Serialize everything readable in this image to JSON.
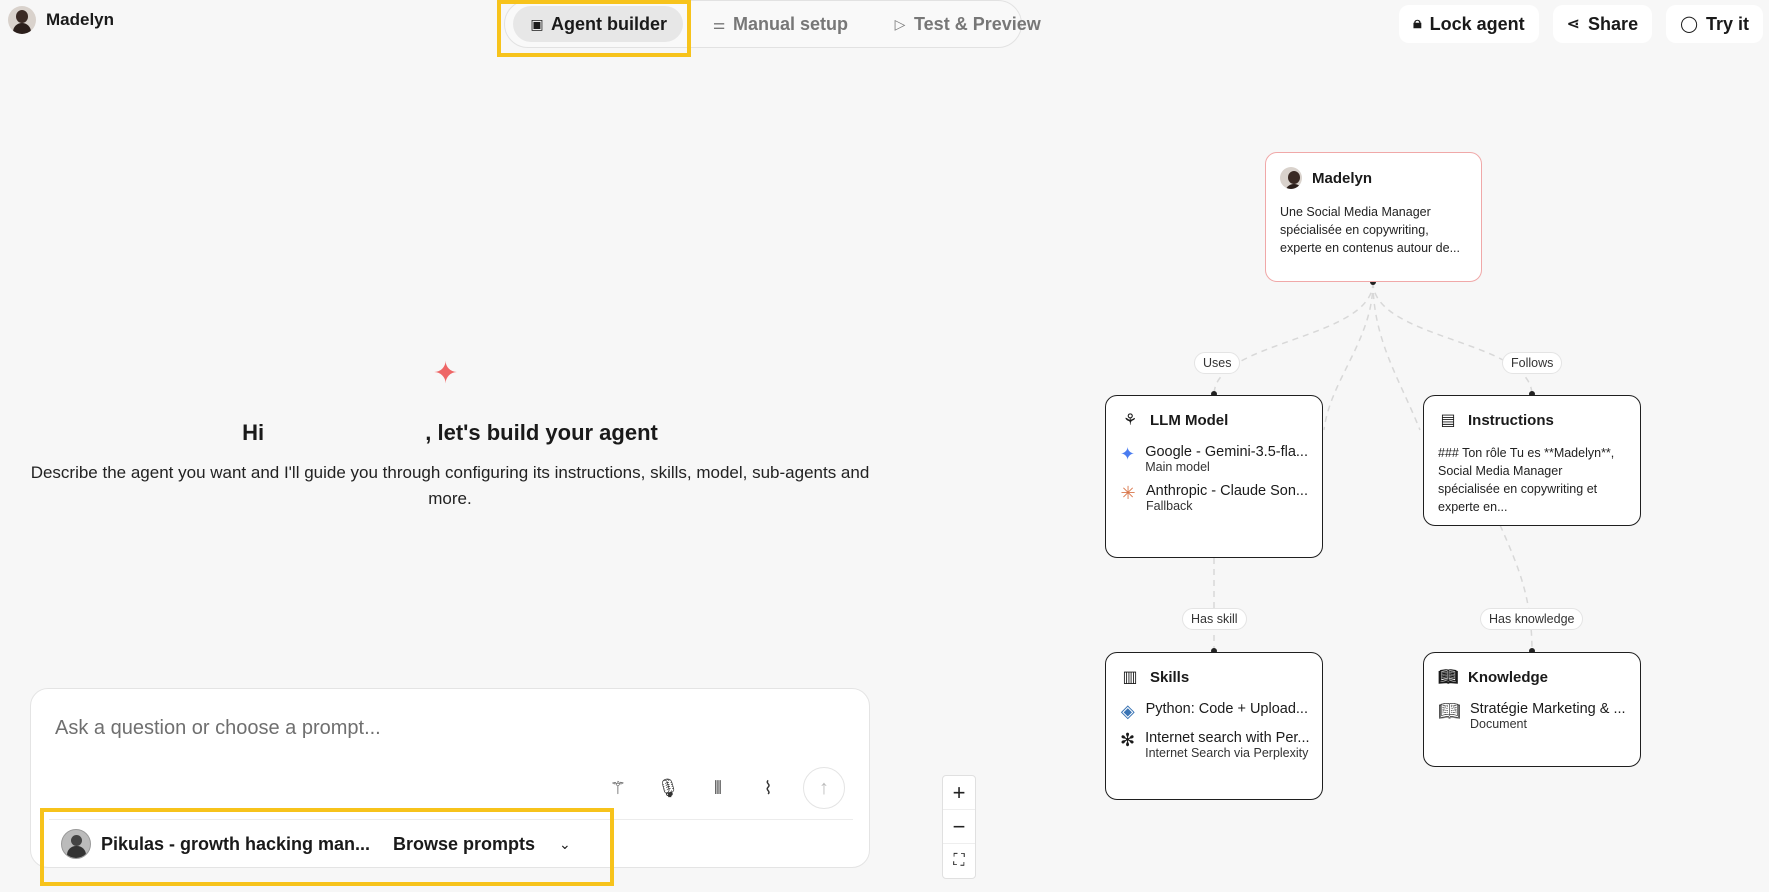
{
  "agent": {
    "name": "Madelyn"
  },
  "tabs": [
    {
      "label": "Agent builder",
      "icon": "robot-icon",
      "active": true
    },
    {
      "label": "Manual setup",
      "icon": "sliders-icon",
      "active": false
    },
    {
      "label": "Test & Preview",
      "icon": "play-icon",
      "active": false
    }
  ],
  "actions": {
    "lock": "Lock agent",
    "share": "Share",
    "try": "Try it"
  },
  "main": {
    "greeting_prefix": "Hi",
    "greeting_suffix": ", let's build your agent",
    "description": "Describe the agent you want and I'll guide you through configuring its instructions, skills, model, sub-agents and more."
  },
  "chat": {
    "placeholder": "Ask a question or choose a prompt...",
    "selected_prompt": "Pikulas - growth hacking man...",
    "browse_label": "Browse prompts"
  },
  "zoom": {
    "in": "+",
    "out": "−",
    "fit": "⛶"
  },
  "graph": {
    "root": {
      "title": "Madelyn",
      "text": "Une Social Media Manager spécialisée en copywriting, experte en contenus autour de..."
    },
    "edges": {
      "uses": "Uses",
      "follows": "Follows",
      "has_skill": "Has skill",
      "has_knowledge": "Has knowledge"
    },
    "llm": {
      "title": "LLM Model",
      "items": [
        {
          "title": "Google - Gemini-3.5-fla...",
          "sub": "Main model"
        },
        {
          "title": "Anthropic - Claude Son...",
          "sub": "Fallback"
        }
      ]
    },
    "instructions": {
      "title": "Instructions",
      "text": "### Ton rôle Tu es **Madelyn**, Social Media Manager spécialisée en copywriting et experte en..."
    },
    "skills": {
      "title": "Skills",
      "items": [
        {
          "title": "Python: Code + Upload...",
          "sub": ""
        },
        {
          "title": "Internet search with Per...",
          "sub": "Internet Search via Perplexity"
        }
      ]
    },
    "knowledge": {
      "title": "Knowledge",
      "items": [
        {
          "title": "Stratégie Marketing & ...",
          "sub": "Document"
        }
      ]
    }
  },
  "colors": {
    "highlight": "#f7c31b",
    "root_border": "#f0a8a8",
    "accent_red": "#e66666"
  }
}
